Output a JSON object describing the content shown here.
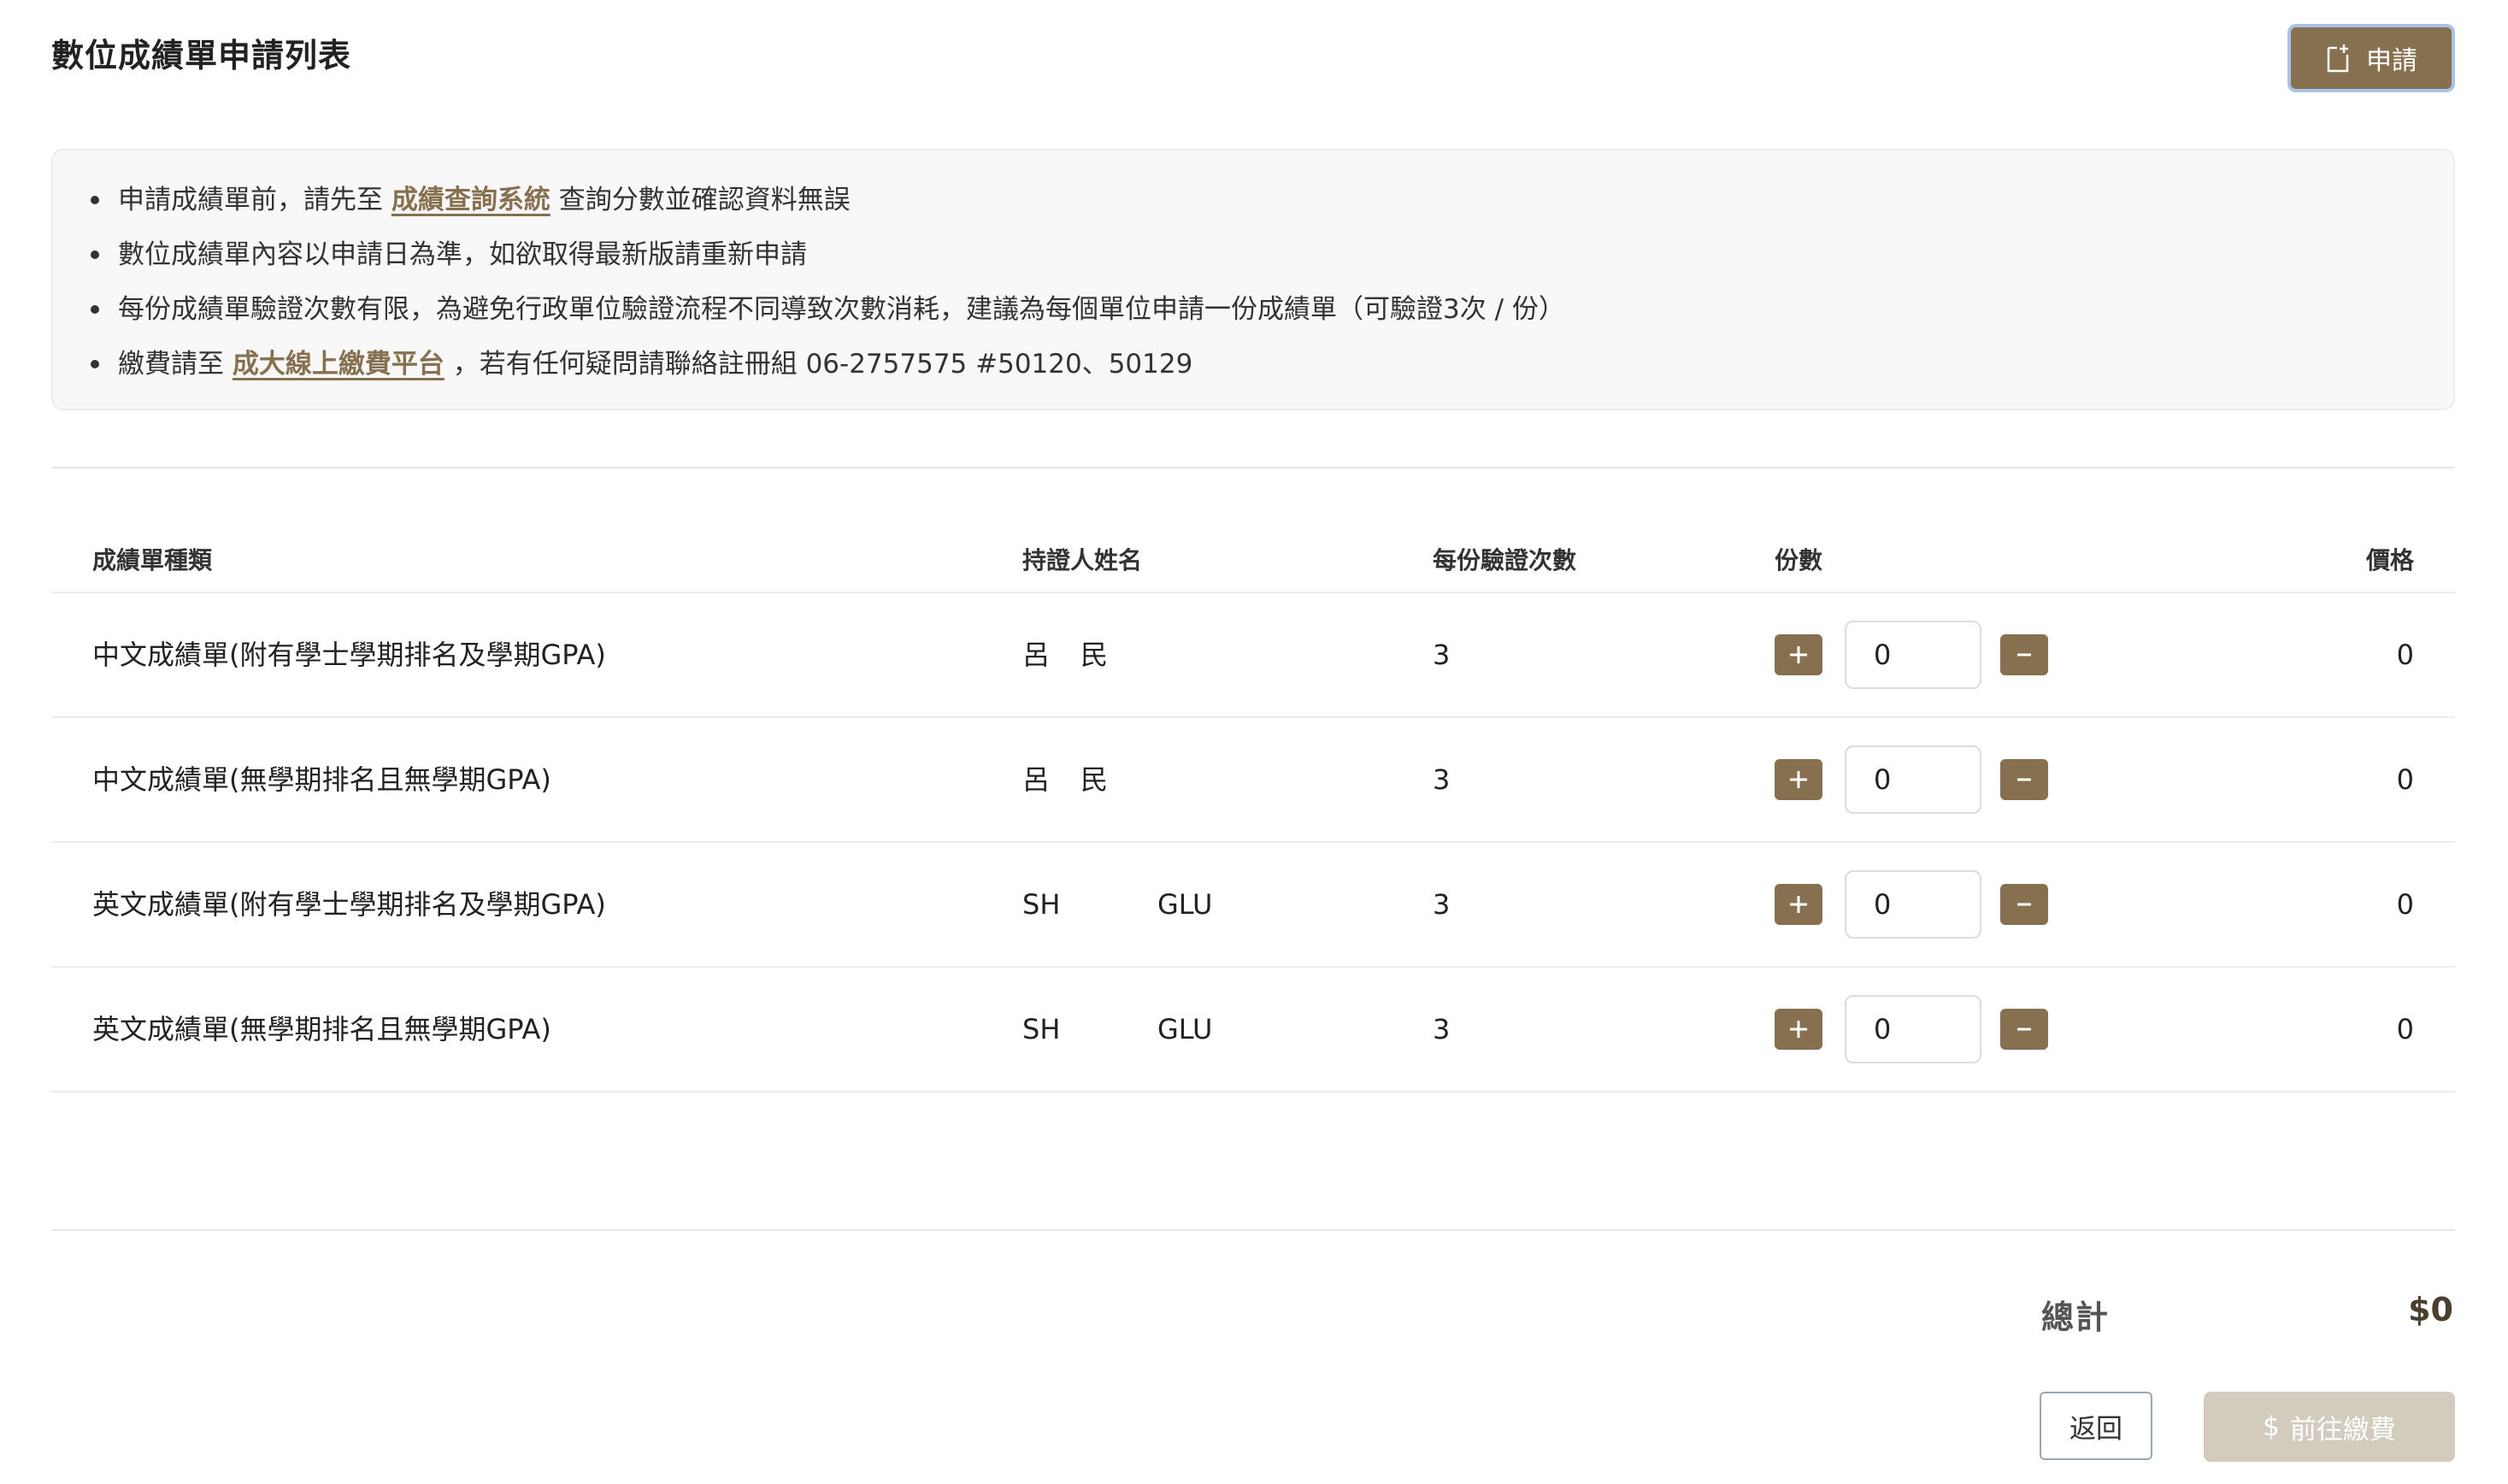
{
  "page": {
    "title": "數位成績單申請列表",
    "apply_button": "申請"
  },
  "notice": {
    "line1": {
      "before": "申請成績單前，請先至",
      "link": "成績查詢系統",
      "after": "查詢分數並確認資料無誤"
    },
    "line2": {
      "text": "數位成績單內容以申請日為準，如欲取得最新版請重新申請"
    },
    "line3": {
      "text": "每份成績單驗證次數有限，為避免行政單位驗證流程不同導致次數消耗，建議為每個單位申請一份成績單（可驗證3次 / 份）"
    },
    "line4": {
      "before": "繳費請至",
      "link": "成大線上繳費平台",
      "after": "，若有任何疑問請聯絡註冊組 06-2757575 #50120、50129"
    }
  },
  "table": {
    "headers": {
      "type": "成績單種類",
      "holder": "持證人姓名",
      "verifications": "每份驗證次數",
      "copies": "份數",
      "price": "價格"
    },
    "rows": [
      {
        "type": "中文成績單(附有學士學期排名及學期GPA)",
        "name_first": "呂",
        "name_last": "民",
        "verifications": "3",
        "copies": "0",
        "price": "0"
      },
      {
        "type": "中文成績單(無學期排名且無學期GPA)",
        "name_first": "呂",
        "name_last": "民",
        "verifications": "3",
        "copies": "0",
        "price": "0"
      },
      {
        "type": "英文成績單(附有學士學期排名及學期GPA)",
        "name_first": "SH",
        "name_last": "GLU",
        "verifications": "3",
        "copies": "0",
        "price": "0"
      },
      {
        "type": "英文成績單(無學期排名且無學期GPA)",
        "name_first": "SH",
        "name_last": "GLU",
        "verifications": "3",
        "copies": "0",
        "price": "0"
      }
    ]
  },
  "footer": {
    "total_label": "總計",
    "total_value": "$0",
    "back_button": "返回",
    "pay_button": "前往繳費",
    "pay_icon": "$"
  },
  "colors": {
    "accent": "#87704f",
    "accent_disabled": "#d4cbbf",
    "notice_bg": "#f8f8f8"
  },
  "icons": {
    "apply": "add-document-icon",
    "plus": "plus-icon",
    "minus": "minus-icon",
    "pay": "dollar-icon"
  }
}
